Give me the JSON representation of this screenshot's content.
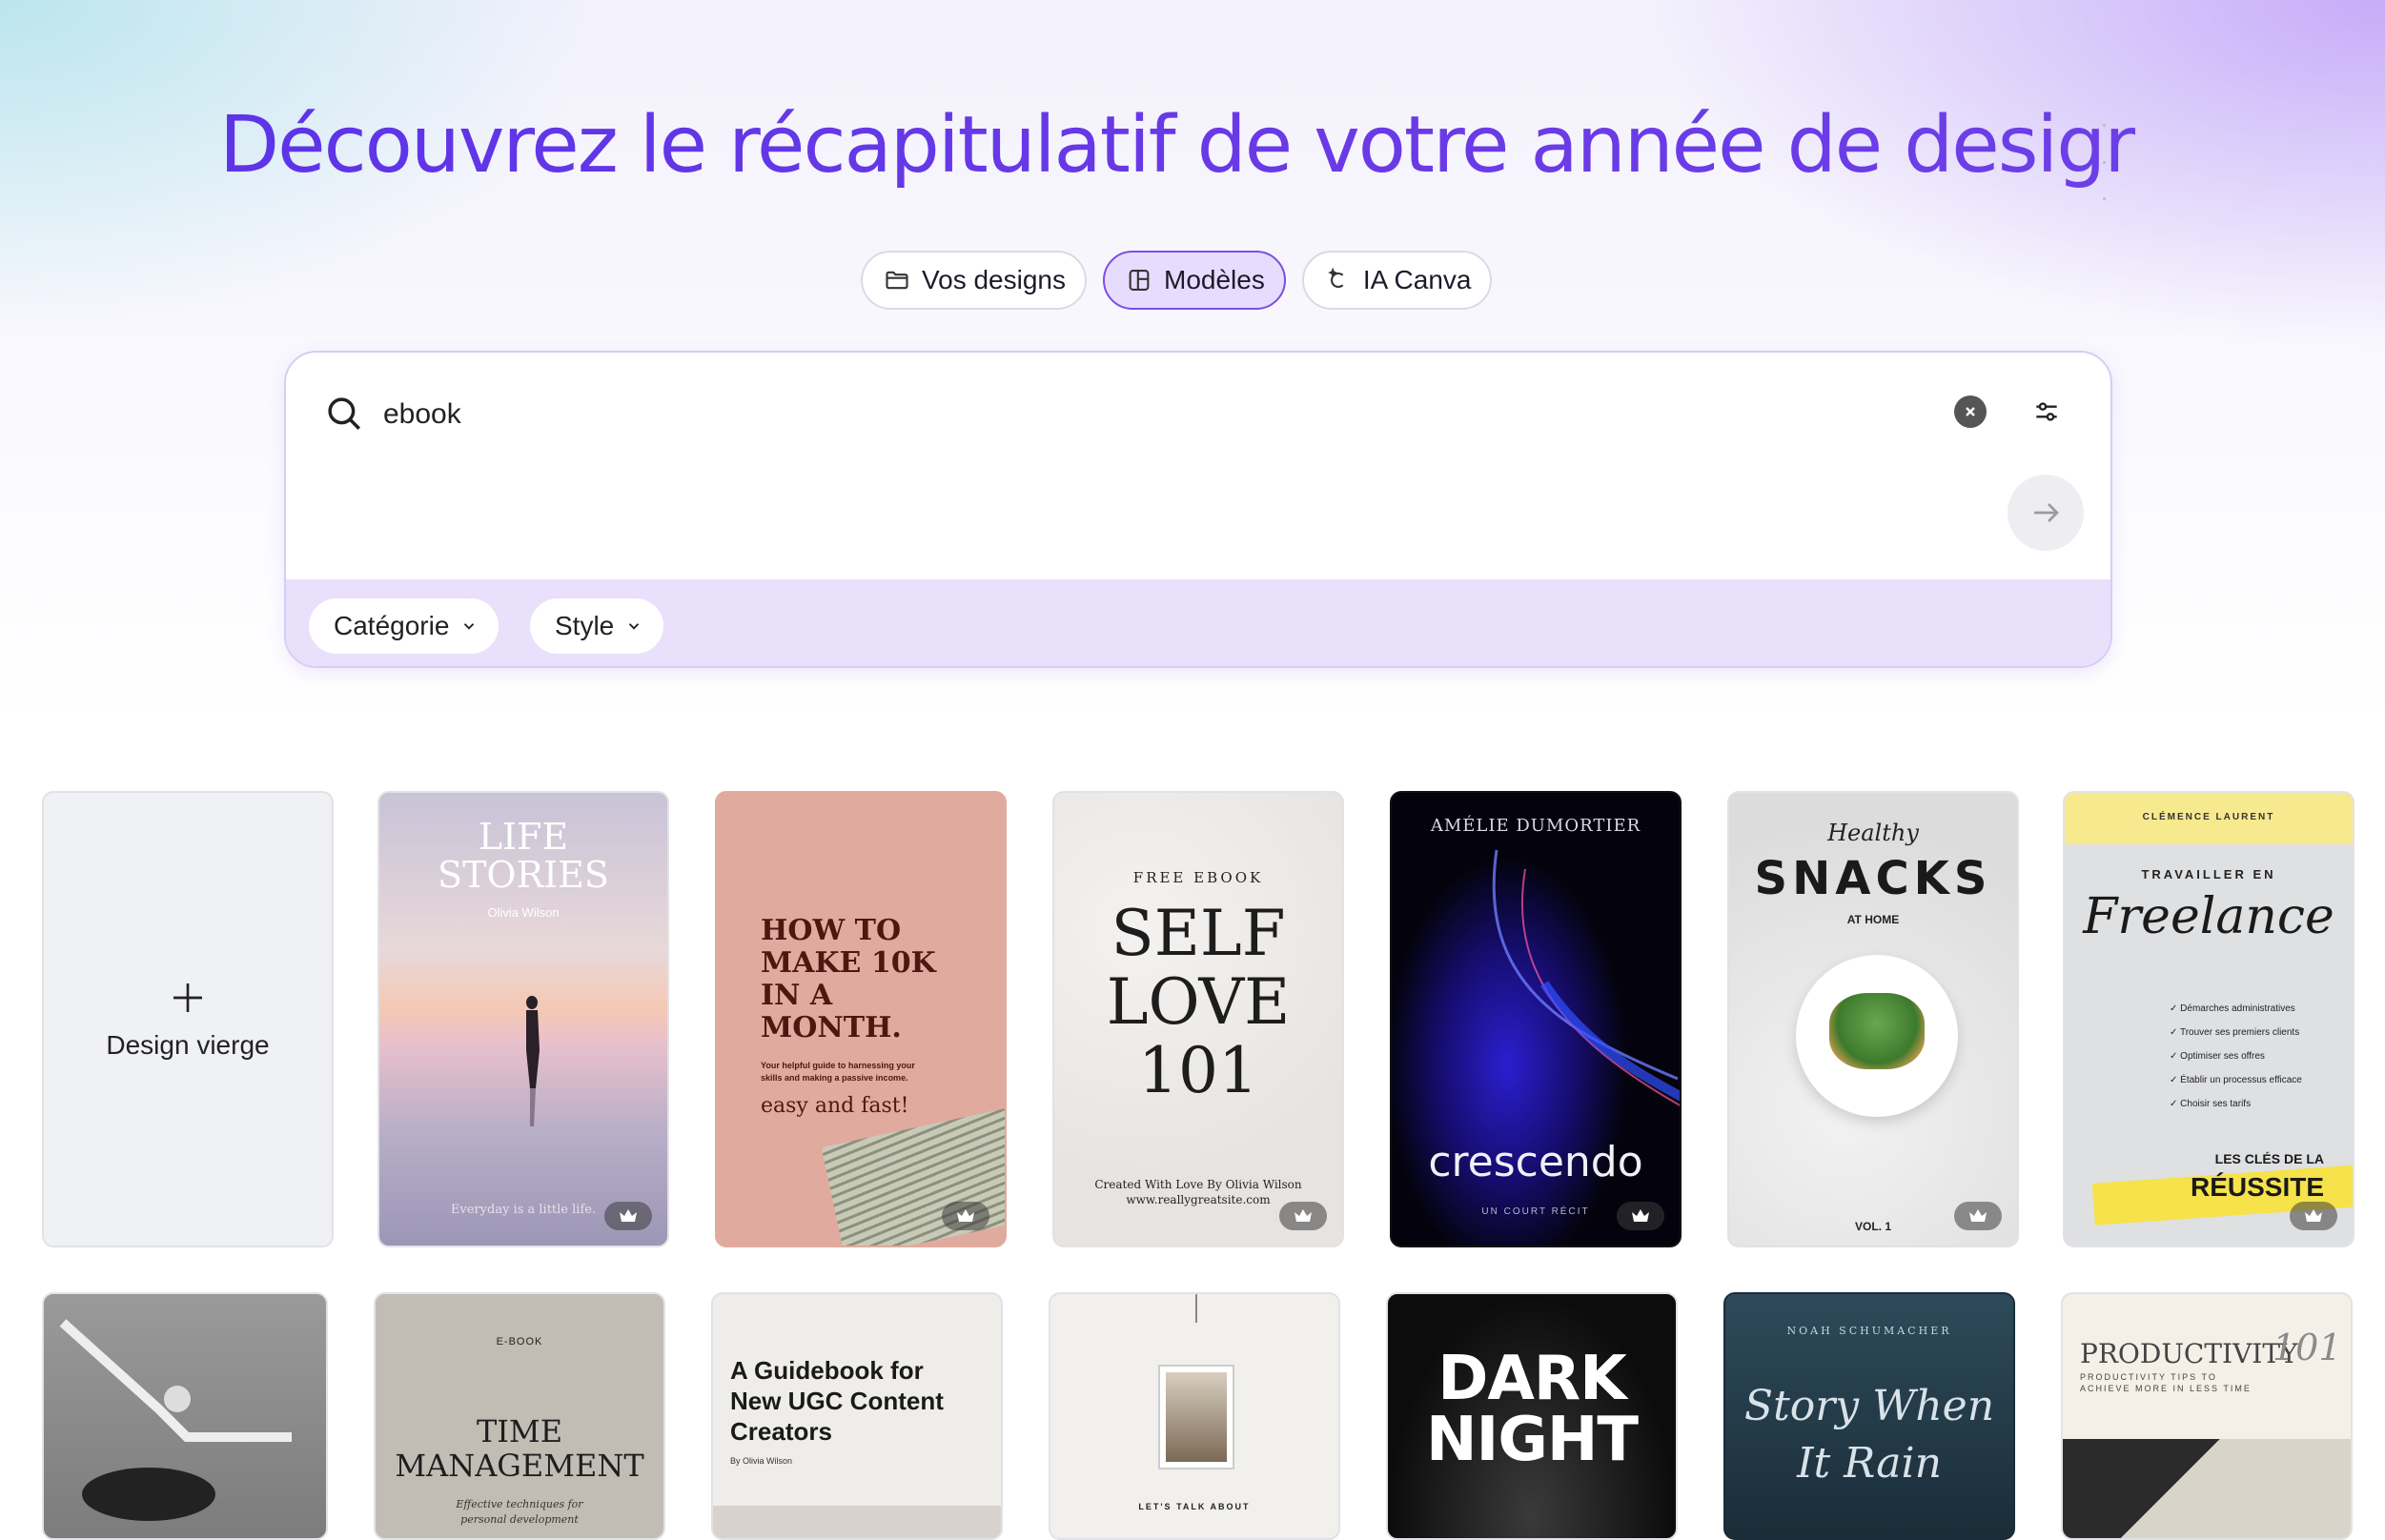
{
  "hero": {
    "title": "Découvrez le récapitulatif de votre année de design"
  },
  "tabs": [
    {
      "label": "Vos designs",
      "icon": "folder-icon",
      "active": false
    },
    {
      "label": "Modèles",
      "icon": "template-icon",
      "active": true
    },
    {
      "label": "IA Canva",
      "icon": "canva-ai-icon",
      "active": false
    }
  ],
  "search": {
    "value": "ebook"
  },
  "filters": {
    "category": "Catégorie",
    "style": "Style"
  },
  "blank_design": {
    "label": "Design vierge",
    "icon": "plus-icon"
  },
  "templates_row1": [
    {
      "title": "LIFE STORIES",
      "author": "Olivia Wilson",
      "footer": "Everyday is a little life."
    },
    {
      "title": "HOW TO MAKE 10K IN A MONTH.",
      "subtitle": "Your helpful guide to harnessing your skills and making a passive income.",
      "tagline": "easy and fast!"
    },
    {
      "kicker": "FREE EBOOK",
      "title_l1": "SELF",
      "title_l2": "LOVE",
      "title_l3": "101",
      "footer1": "Created With Love By Olivia Wilson",
      "footer2": "www.reallygreatsite.com"
    },
    {
      "author": "AMÉLIE DUMORTIER",
      "title": "crescendo",
      "subtitle": "UN COURT RÉCIT"
    },
    {
      "script": "Healthy",
      "title": "SNACKS",
      "subtitle": "AT HOME",
      "footer": "VOL. 1"
    },
    {
      "author": "CLÉMENCE LAURENT",
      "kicker": "TRAVAILLER EN",
      "script": "Freelance",
      "items": [
        "Démarches administratives",
        "Trouver ses premiers clients",
        "Optimiser ses offres",
        "Établir un processus efficace",
        "Choisir ses tarifs"
      ],
      "footer1": "LES CLÉS DE LA",
      "footer2": "RÉUSSITE"
    }
  ],
  "templates_row2": [
    {
      "kicker": "E-BOOK",
      "title_l1": "TIME",
      "title_l2": "MANAGEMENT",
      "subtitle_l1": "Effective techniques for",
      "subtitle_l2": "personal development"
    },
    {
      "title_l1": "A Guidebook for",
      "title_l2": "New UGC Content",
      "title_l3": "Creators",
      "author": "By Olivia Wilson"
    },
    {
      "footer": "LET'S TALK ABOUT"
    },
    {
      "title_l1": "DARK",
      "title_l2": "NIGHT"
    },
    {
      "author": "NOAH SCHUMACHER",
      "script_l1": "Story When",
      "script_l2": "It Rain"
    },
    {
      "title": "PRODUCTIVITY",
      "script": "101",
      "subtitle_l1": "PRODUCTIVITY TIPS TO",
      "subtitle_l2": "ACHIEVE MORE IN LESS TIME"
    }
  ],
  "colors": {
    "accent": "#5a33e6",
    "active_tab_bg": "#e7dcfd",
    "filter_bar": "#e9e0fc"
  }
}
